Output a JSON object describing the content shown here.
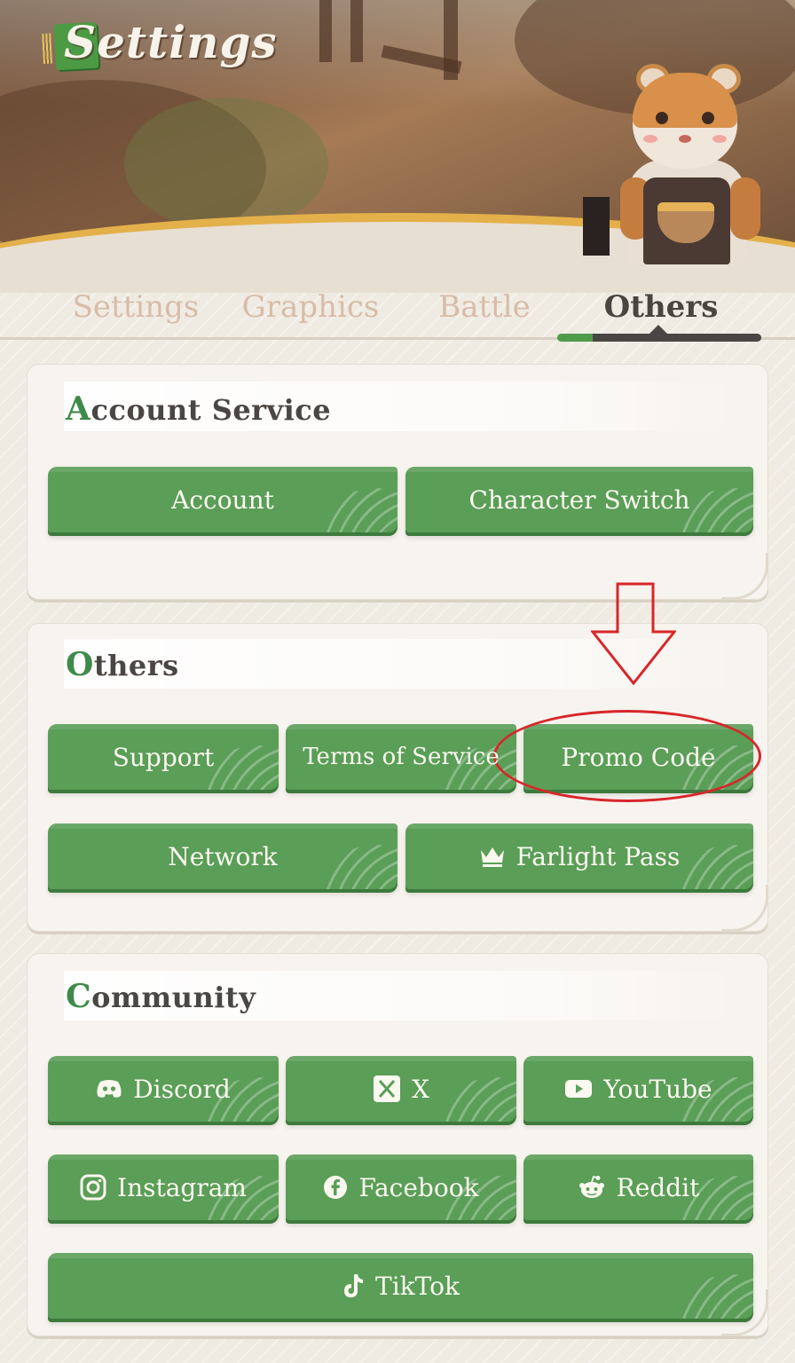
{
  "header": {
    "title": "Settings"
  },
  "tabs": [
    {
      "label": "Settings",
      "active": false
    },
    {
      "label": "Graphics",
      "active": false
    },
    {
      "label": "Battle",
      "active": false
    },
    {
      "label": "Others",
      "active": true
    }
  ],
  "sections": {
    "account_service": {
      "title_first": "A",
      "title_rest": "ccount Service",
      "buttons": {
        "account": "Account",
        "character_switch": "Character Switch"
      }
    },
    "others": {
      "title_first": "O",
      "title_rest": "thers",
      "buttons": {
        "support": "Support",
        "terms": "Terms of Service",
        "promo": "Promo Code",
        "network": "Network",
        "farlight_pass": "Farlight Pass"
      }
    },
    "community": {
      "title_first": "C",
      "title_rest": "ommunity",
      "buttons": {
        "discord": "Discord",
        "x": "X",
        "youtube": "YouTube",
        "instagram": "Instagram",
        "facebook": "Facebook",
        "reddit": "Reddit",
        "tiktok": "TikTok"
      }
    }
  },
  "icons": {
    "farlight_pass": "crown-icon",
    "discord": "discord-icon",
    "x": "x-icon",
    "youtube": "youtube-icon",
    "instagram": "instagram-icon",
    "facebook": "facebook-icon",
    "reddit": "reddit-icon",
    "tiktok": "tiktok-icon"
  },
  "colors": {
    "button_green": "#5a9e57",
    "active_tab": "#4a4540",
    "inactive_tab": "#d8bca8",
    "annotation_red": "#d8262a"
  }
}
